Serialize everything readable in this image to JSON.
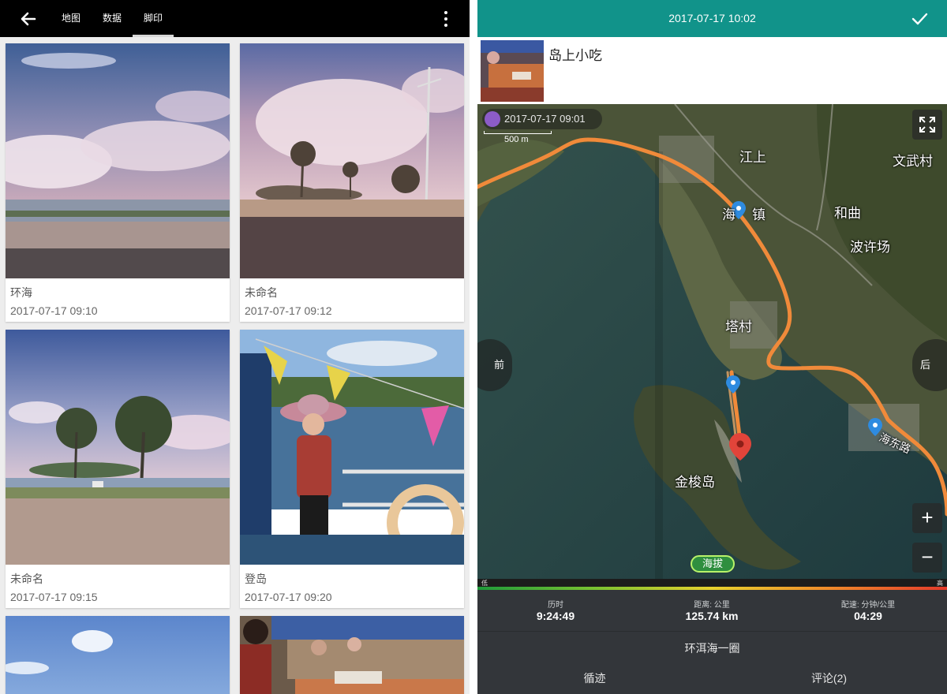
{
  "left": {
    "tabs": [
      {
        "label": "地图"
      },
      {
        "label": "数据"
      },
      {
        "label": "脚印"
      }
    ],
    "cards": [
      {
        "title": "环海",
        "time": "2017-07-17 09:10"
      },
      {
        "title": "未命名",
        "time": "2017-07-17 09:12"
      },
      {
        "title": "未命名",
        "time": "2017-07-17 09:15"
      },
      {
        "title": "登岛",
        "time": "2017-07-17 09:20"
      }
    ]
  },
  "right": {
    "header_title": "2017-07-17 10:02",
    "poi_title": "岛上小吃",
    "map": {
      "time_badge": "2017-07-17 09:01",
      "scale": "500 m",
      "prev": "前",
      "next": "后",
      "zoom_in": "+",
      "zoom_out": "−",
      "elevation_button": "海拔",
      "place_labels": [
        "江上",
        "文武村",
        "海",
        "镇",
        "和曲",
        "波许场",
        "塔村",
        "金梭岛",
        "海东路"
      ]
    },
    "legend": {
      "low": "低",
      "high": "高"
    },
    "stats": [
      {
        "label": "历时",
        "value": "9:24:49"
      },
      {
        "label": "距离: 公里",
        "value": "125.74 km"
      },
      {
        "label": "配速: 分钟/公里",
        "value": "04:29"
      }
    ],
    "route_name": "环洱海一圈",
    "bottom_tabs": [
      {
        "label": "循迹"
      },
      {
        "label": "评论(2)"
      }
    ]
  }
}
